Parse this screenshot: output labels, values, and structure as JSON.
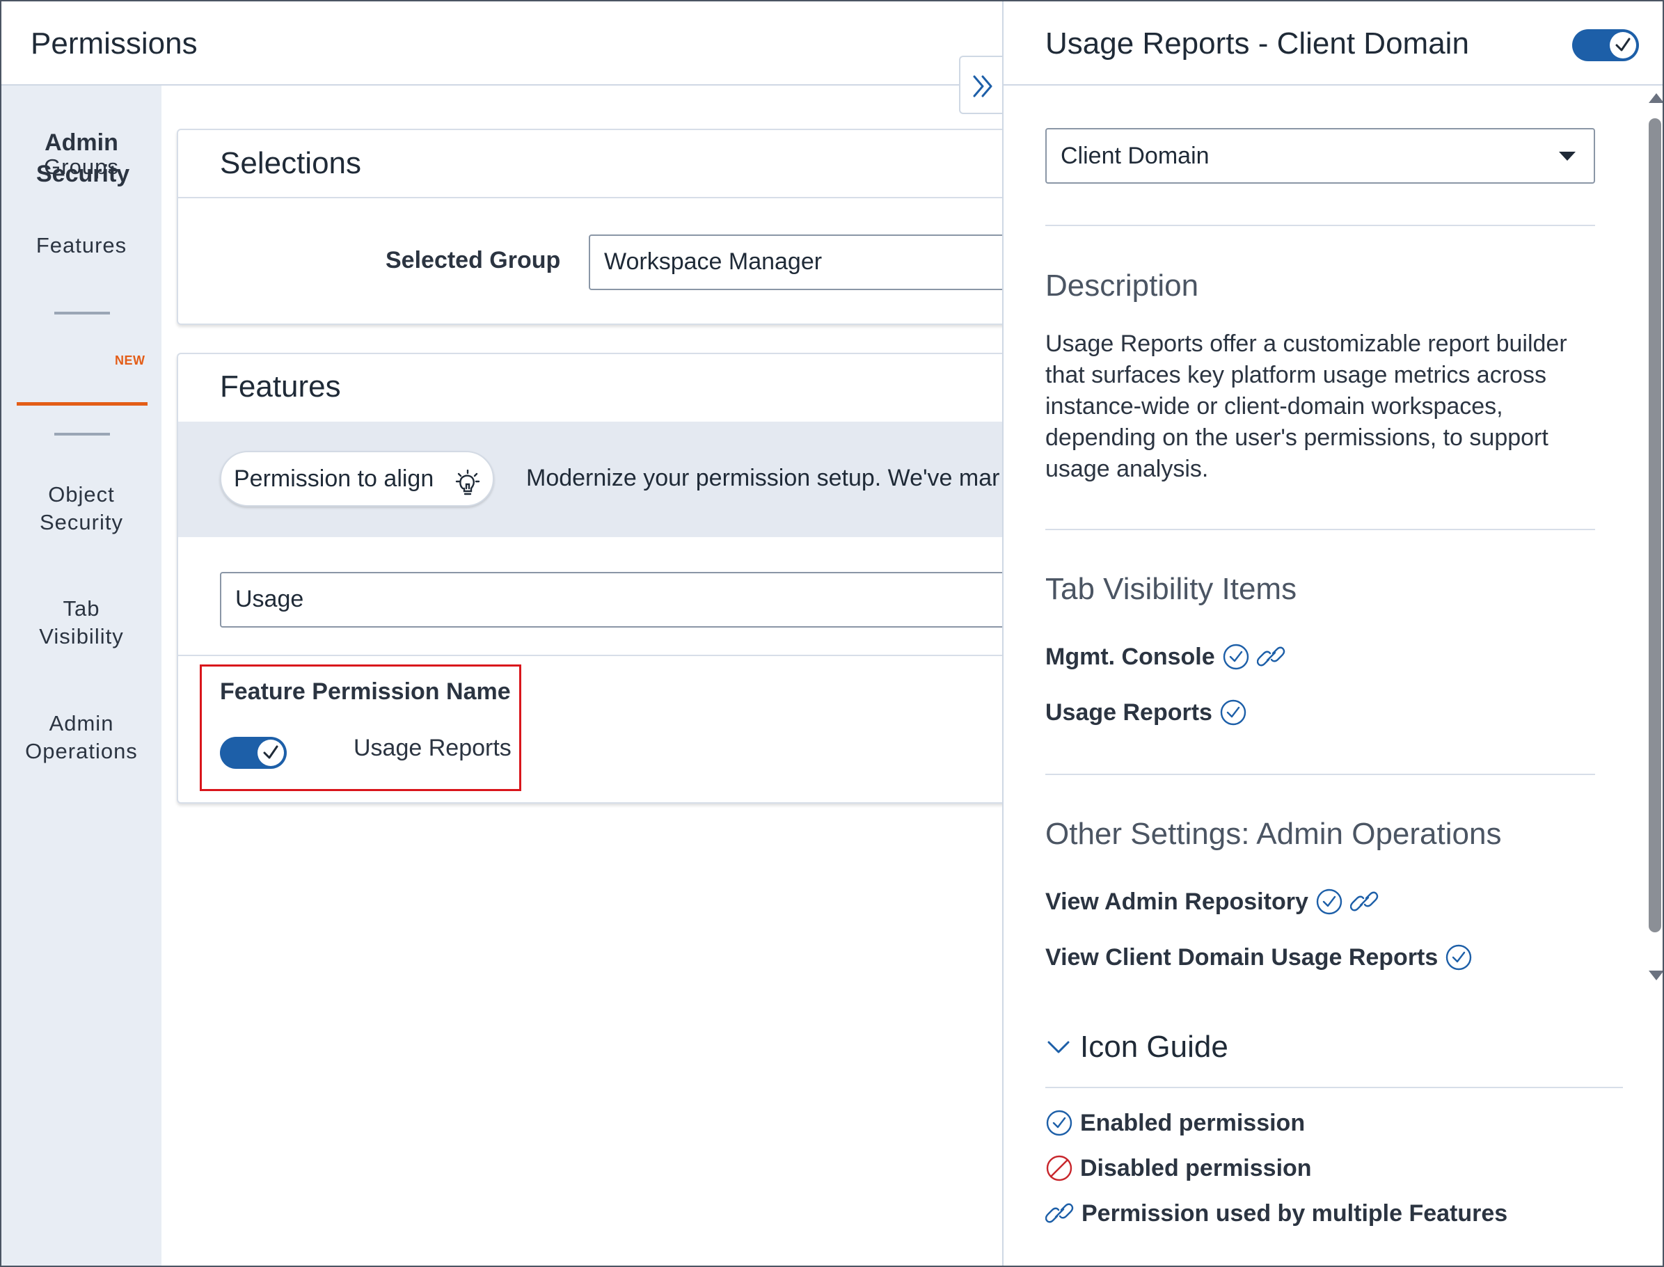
{
  "app": {
    "title": "Permissions"
  },
  "sidenav": {
    "heading": "Admin Security",
    "items": [
      {
        "label": "Groups"
      },
      {
        "label": "Features",
        "badge": "NEW",
        "active": true
      },
      {
        "label": "Object Security"
      },
      {
        "label": "Tab Visibility"
      },
      {
        "label": "Admin Operations"
      }
    ]
  },
  "selections": {
    "title": "Selections",
    "group_label": "Selected Group",
    "group_value": "Workspace Manager"
  },
  "features": {
    "title": "Features",
    "pill_label": "Permission to align",
    "banner_text": "Modernize your permission setup. We've mar",
    "search_value": "Usage",
    "column_header": "Feature Permission Name",
    "rows": [
      {
        "name": "Usage Reports",
        "enabled": true
      }
    ]
  },
  "panel": {
    "title": "Usage Reports - Client Domain",
    "enabled": true,
    "scope_select": "Client Domain",
    "description_title": "Description",
    "description": "Usage Reports offer a customizable report builder that surfaces key platform usage metrics across instance-wide or client-domain workspaces, depending on the user's permissions, to support usage analysis.",
    "tab_visibility_title": "Tab Visibility Items",
    "tab_visibility_items": [
      {
        "label": "Mgmt. Console",
        "enabled": true,
        "shared": true
      },
      {
        "label": "Usage Reports",
        "enabled": true,
        "shared": false
      }
    ],
    "other_settings_title": "Other Settings: Admin Operations",
    "other_settings_items": [
      {
        "label": "View Admin Repository",
        "enabled": true,
        "shared": true
      },
      {
        "label": "View Client Domain Usage Reports",
        "enabled": true,
        "shared": false
      }
    ],
    "icon_guide_title": "Icon Guide",
    "icon_guide": [
      {
        "icon": "enabled-check-icon",
        "label": "Enabled permission"
      },
      {
        "icon": "disabled-icon",
        "label": "Disabled permission"
      },
      {
        "icon": "link-icon",
        "label": "Permission used by multiple Features"
      }
    ]
  },
  "colors": {
    "accent": "#1d5fa8",
    "active_tab": "#e35d17",
    "highlight": "#d9161c",
    "disabled": "#c8262c"
  }
}
